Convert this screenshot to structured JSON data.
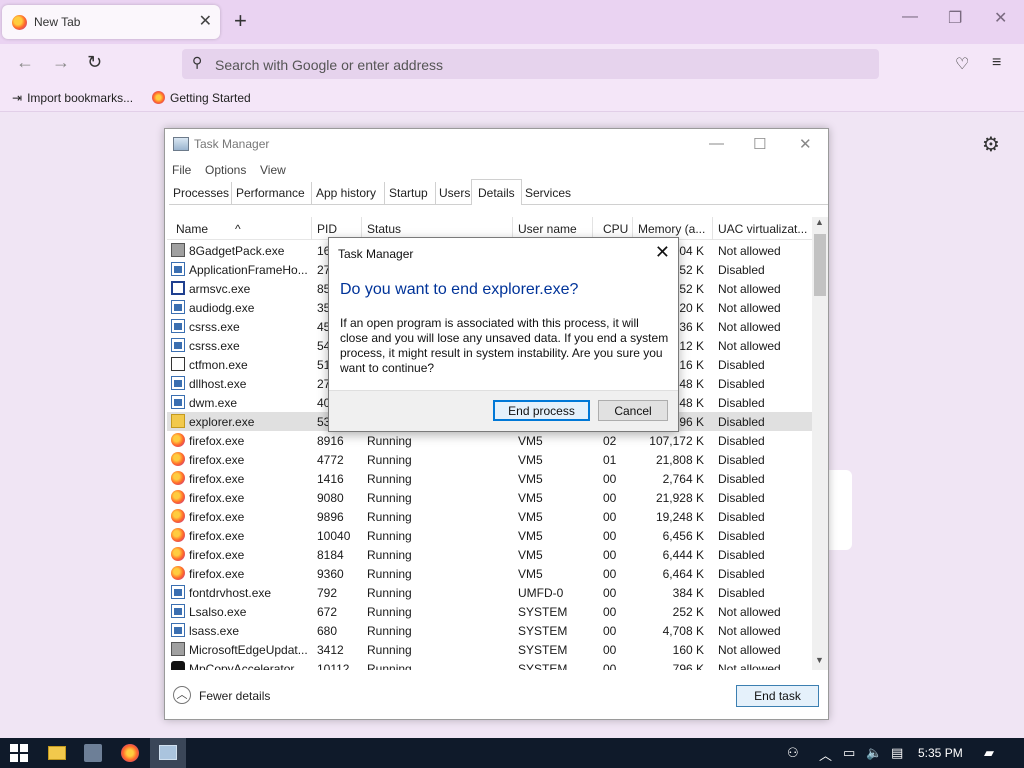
{
  "browser": {
    "tab_title": "New Tab",
    "search_placeholder": "Search with Google or enter address",
    "bookmarks": [
      "Import bookmarks...",
      "Getting Started"
    ]
  },
  "task_manager": {
    "title": "Task Manager",
    "menu": [
      "File",
      "Options",
      "View"
    ],
    "tabs": [
      "Processes",
      "Performance",
      "App history",
      "Startup",
      "Users",
      "Details",
      "Services"
    ],
    "active_tab": "Details",
    "columns": [
      "Name",
      "PID",
      "Status",
      "User name",
      "CPU",
      "Memory (a...",
      "UAC virtualizat..."
    ],
    "rows": [
      {
        "icon": "gadget",
        "name": "8GadgetPack.exe",
        "pid": "16",
        "status": "",
        "user": "",
        "cpu": "",
        "mem": "04 K",
        "uac": "Not allowed"
      },
      {
        "icon": "win",
        "name": "ApplicationFrameHo...",
        "pid": "27",
        "status": "",
        "user": "",
        "cpu": "",
        "mem": "52 K",
        "uac": "Disabled"
      },
      {
        "icon": "outline",
        "name": "armsvc.exe",
        "pid": "85",
        "status": "",
        "user": "",
        "cpu": "",
        "mem": "52 K",
        "uac": "Not allowed"
      },
      {
        "icon": "win",
        "name": "audiodg.exe",
        "pid": "35",
        "status": "",
        "user": "",
        "cpu": "",
        "mem": "20 K",
        "uac": "Not allowed"
      },
      {
        "icon": "win",
        "name": "csrss.exe",
        "pid": "45",
        "status": "",
        "user": "",
        "cpu": "",
        "mem": "36 K",
        "uac": "Not allowed"
      },
      {
        "icon": "win",
        "name": "csrss.exe",
        "pid": "54",
        "status": "",
        "user": "",
        "cpu": "",
        "mem": "12 K",
        "uac": "Not allowed"
      },
      {
        "icon": "pen",
        "name": "ctfmon.exe",
        "pid": "51",
        "status": "",
        "user": "",
        "cpu": "",
        "mem": "16 K",
        "uac": "Disabled"
      },
      {
        "icon": "win",
        "name": "dllhost.exe",
        "pid": "27",
        "status": "",
        "user": "",
        "cpu": "",
        "mem": "48 K",
        "uac": "Disabled"
      },
      {
        "icon": "win",
        "name": "dwm.exe",
        "pid": "40",
        "status": "",
        "user": "",
        "cpu": "",
        "mem": "48 K",
        "uac": "Disabled"
      },
      {
        "icon": "folder",
        "name": "explorer.exe",
        "pid": "53",
        "status": "",
        "user": "",
        "cpu": "",
        "mem": "96 K",
        "uac": "Disabled",
        "selected": true
      },
      {
        "icon": "ff",
        "name": "firefox.exe",
        "pid": "8916",
        "status": "Running",
        "user": "VM5",
        "cpu": "02",
        "mem": "107,172 K",
        "uac": "Disabled"
      },
      {
        "icon": "ff",
        "name": "firefox.exe",
        "pid": "4772",
        "status": "Running",
        "user": "VM5",
        "cpu": "01",
        "mem": "21,808 K",
        "uac": "Disabled"
      },
      {
        "icon": "ff",
        "name": "firefox.exe",
        "pid": "1416",
        "status": "Running",
        "user": "VM5",
        "cpu": "00",
        "mem": "2,764 K",
        "uac": "Disabled"
      },
      {
        "icon": "ff",
        "name": "firefox.exe",
        "pid": "9080",
        "status": "Running",
        "user": "VM5",
        "cpu": "00",
        "mem": "21,928 K",
        "uac": "Disabled"
      },
      {
        "icon": "ff",
        "name": "firefox.exe",
        "pid": "9896",
        "status": "Running",
        "user": "VM5",
        "cpu": "00",
        "mem": "19,248 K",
        "uac": "Disabled"
      },
      {
        "icon": "ff",
        "name": "firefox.exe",
        "pid": "10040",
        "status": "Running",
        "user": "VM5",
        "cpu": "00",
        "mem": "6,456 K",
        "uac": "Disabled"
      },
      {
        "icon": "ff",
        "name": "firefox.exe",
        "pid": "8184",
        "status": "Running",
        "user": "VM5",
        "cpu": "00",
        "mem": "6,444 K",
        "uac": "Disabled"
      },
      {
        "icon": "ff",
        "name": "firefox.exe",
        "pid": "9360",
        "status": "Running",
        "user": "VM5",
        "cpu": "00",
        "mem": "6,464 K",
        "uac": "Disabled"
      },
      {
        "icon": "win",
        "name": "fontdrvhost.exe",
        "pid": "792",
        "status": "Running",
        "user": "UMFD-0",
        "cpu": "00",
        "mem": "384 K",
        "uac": "Disabled"
      },
      {
        "icon": "win",
        "name": "Lsalso.exe",
        "pid": "672",
        "status": "Running",
        "user": "SYSTEM",
        "cpu": "00",
        "mem": "252 K",
        "uac": "Not allowed"
      },
      {
        "icon": "win",
        "name": "lsass.exe",
        "pid": "680",
        "status": "Running",
        "user": "SYSTEM",
        "cpu": "00",
        "mem": "4,708 K",
        "uac": "Not allowed"
      },
      {
        "icon": "gadget",
        "name": "MicrosoftEdgeUpdat...",
        "pid": "3412",
        "status": "Running",
        "user": "SYSTEM",
        "cpu": "00",
        "mem": "160 K",
        "uac": "Not allowed"
      },
      {
        "icon": "black",
        "name": "MpCopyAccelerator...",
        "pid": "10112",
        "status": "Running",
        "user": "SYSTEM",
        "cpu": "00",
        "mem": "796 K",
        "uac": "Not allowed"
      }
    ],
    "fewer_details": "Fewer details",
    "end_task": "End task"
  },
  "dialog": {
    "title": "Task Manager",
    "heading": "Do you want to end explorer.exe?",
    "body": "If an open program is associated with this process, it will close and you will lose any unsaved data. If you end a system process, it might result in system instability. Are you sure you want to continue?",
    "primary": "End process",
    "cancel": "Cancel"
  },
  "taskbar": {
    "time": "5:35 PM"
  }
}
